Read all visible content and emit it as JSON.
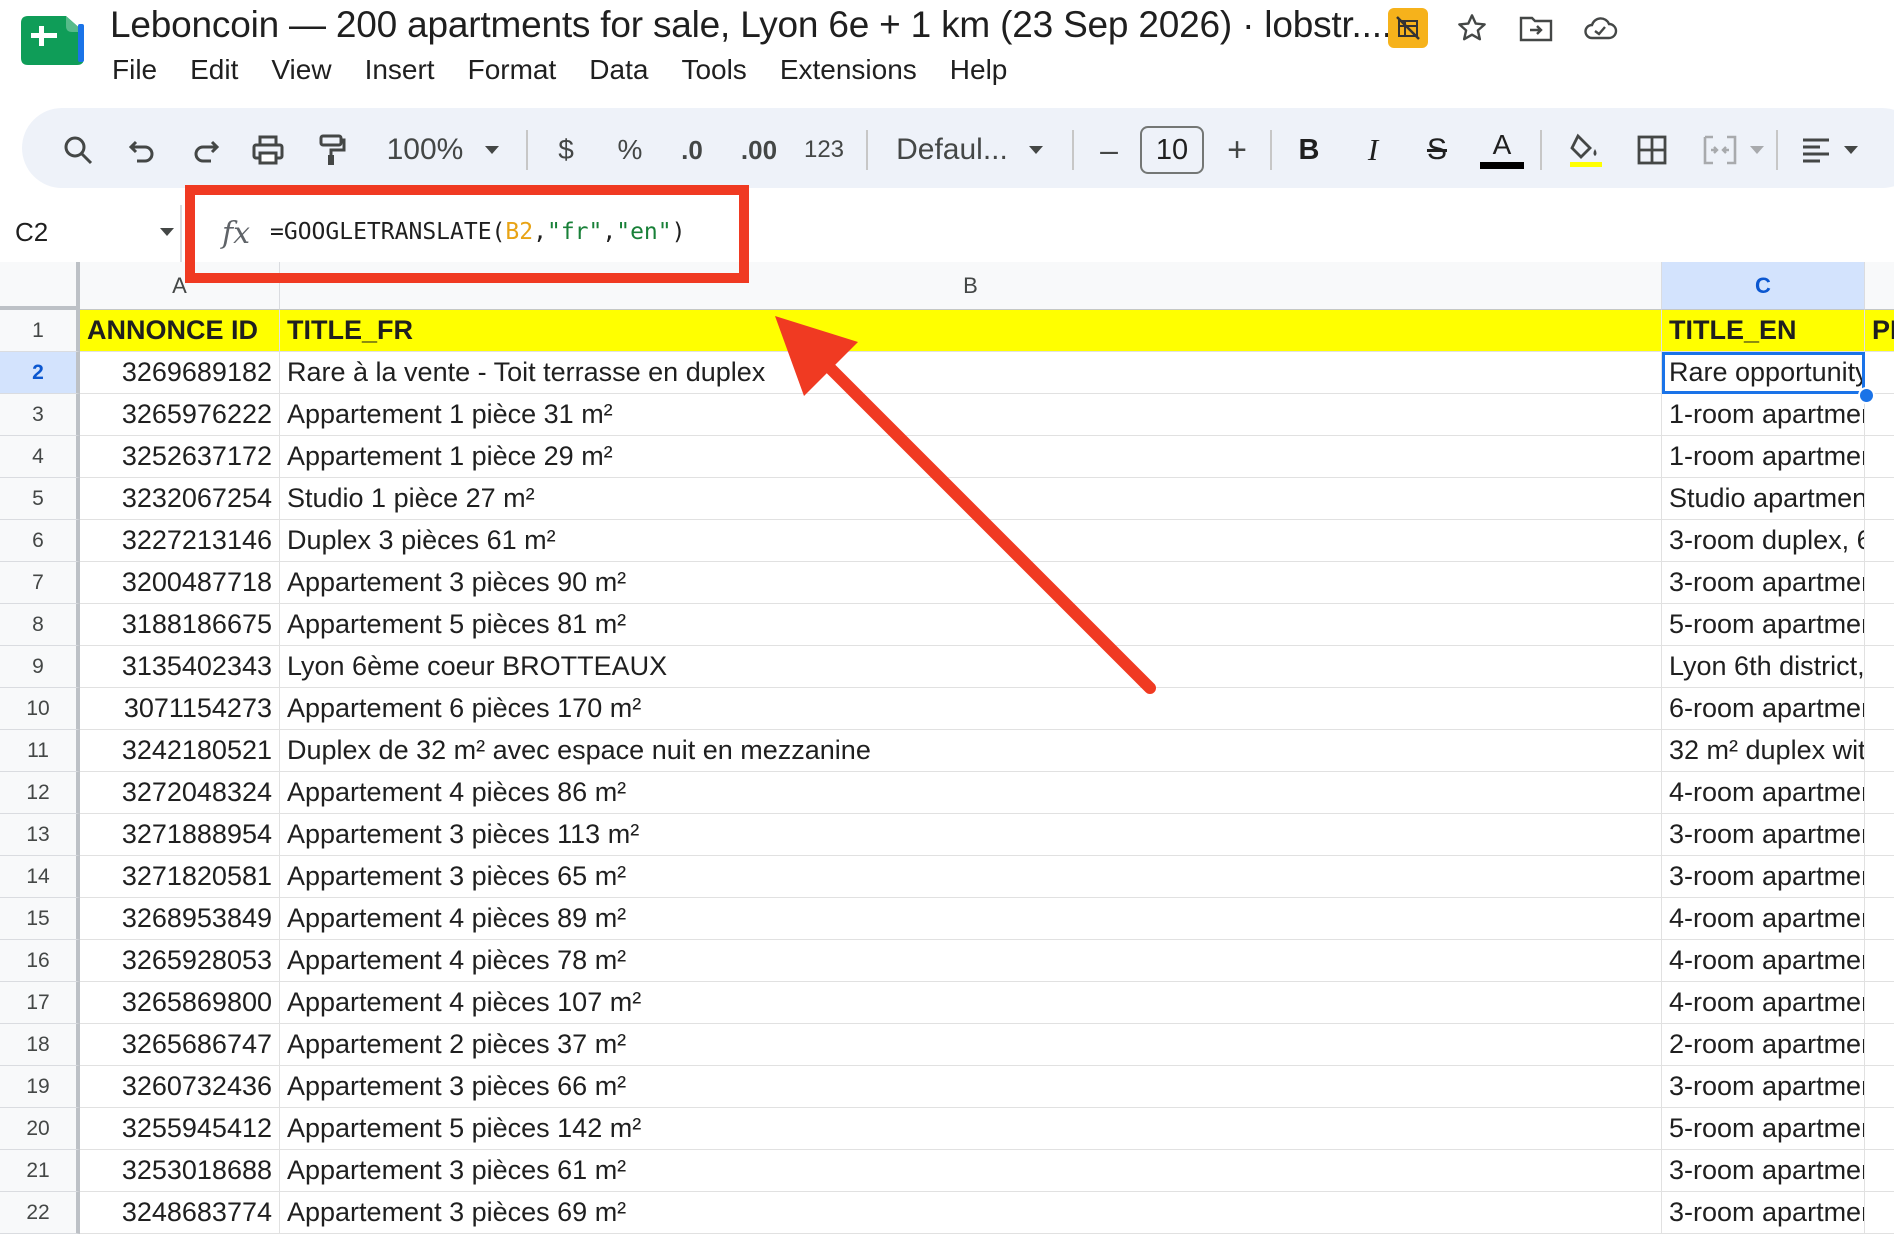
{
  "title": {
    "doc_title": "Leboncoin — 200 apartments for sale, Lyon 6e + 1 km (23 Sep 2026) · lobstr....",
    "icons": [
      "no-formatting-icon",
      "star-icon",
      "move-to-folder-icon",
      "cloud-saved-icon"
    ]
  },
  "menu": [
    "File",
    "Edit",
    "View",
    "Insert",
    "Format",
    "Data",
    "Tools",
    "Extensions",
    "Help"
  ],
  "toolbar": {
    "zoom": "100%",
    "currency": "$",
    "percent": "%",
    "decrease_decimal": ".0",
    "increase_decimal": ".00",
    "number_format": "123",
    "font": "Defaul...",
    "font_size": "10",
    "minus": "–",
    "plus": "+",
    "bold": "B",
    "italic": "I",
    "strike": "S",
    "text_color": "A"
  },
  "formula_bar": {
    "cell_ref": "C2",
    "fx": "fx",
    "formula_prefix": "=GOOGLETRANSLATE(",
    "formula_ref": "B2",
    "formula_comma1": ",",
    "formula_arg1": "\"fr\"",
    "formula_comma2": ",",
    "formula_arg2": "\"en\"",
    "formula_suffix": ")"
  },
  "columns": [
    "A",
    "B",
    "C"
  ],
  "header_row": {
    "row": "1",
    "a": "ANNONCE ID",
    "b": "TITLE_FR",
    "c": "TITLE_EN",
    "d": "PI"
  },
  "rows": [
    {
      "n": "2",
      "id": "3269689182",
      "fr": "Rare à la vente - Toit terrasse en duplex",
      "en": "Rare opportunity"
    },
    {
      "n": "3",
      "id": "3265976222",
      "fr": "Appartement 1 pièce 31 m²",
      "en": "1-room apartmen"
    },
    {
      "n": "4",
      "id": "3252637172",
      "fr": "Appartement 1 pièce 29 m²",
      "en": "1-room apartmen"
    },
    {
      "n": "5",
      "id": "3232067254",
      "fr": "Studio 1 pièce 27 m²",
      "en": "Studio apartmen"
    },
    {
      "n": "6",
      "id": "3227213146",
      "fr": "Duplex 3 pièces 61 m²",
      "en": "3-room duplex, 6"
    },
    {
      "n": "7",
      "id": "3200487718",
      "fr": "Appartement 3 pièces 90 m²",
      "en": "3-room apartmen"
    },
    {
      "n": "8",
      "id": "3188186675",
      "fr": "Appartement 5 pièces 81 m²",
      "en": "5-room apartmen"
    },
    {
      "n": "9",
      "id": "3135402343",
      "fr": "Lyon 6ème coeur BROTTEAUX",
      "en": "Lyon 6th district,"
    },
    {
      "n": "10",
      "id": "3071154273",
      "fr": "Appartement 6 pièces 170 m²",
      "en": "6-room apartmen"
    },
    {
      "n": "11",
      "id": "3242180521",
      "fr": "Duplex de 32 m² avec espace nuit en mezzanine",
      "en": "32 m² duplex wit"
    },
    {
      "n": "12",
      "id": "3272048324",
      "fr": "Appartement 4 pièces 86 m²",
      "en": "4-room apartmen"
    },
    {
      "n": "13",
      "id": "3271888954",
      "fr": "Appartement 3 pièces 113 m²",
      "en": "3-room apartmen"
    },
    {
      "n": "14",
      "id": "3271820581",
      "fr": "Appartement 3 pièces 65 m²",
      "en": "3-room apartmen"
    },
    {
      "n": "15",
      "id": "3268953849",
      "fr": "Appartement 4 pièces 89 m²",
      "en": "4-room apartmen"
    },
    {
      "n": "16",
      "id": "3265928053",
      "fr": "Appartement 4 pièces 78 m²",
      "en": "4-room apartmen"
    },
    {
      "n": "17",
      "id": "3265869800",
      "fr": "Appartement 4 pièces 107 m²",
      "en": "4-room apartmen"
    },
    {
      "n": "18",
      "id": "3265686747",
      "fr": "Appartement 2 pièces 37 m²",
      "en": "2-room apartmen"
    },
    {
      "n": "19",
      "id": "3260732436",
      "fr": "Appartement 3 pièces 66 m²",
      "en": "3-room apartmen"
    },
    {
      "n": "20",
      "id": "3255945412",
      "fr": "Appartement 5 pièces 142 m²",
      "en": "5-room apartmen"
    },
    {
      "n": "21",
      "id": "3253018688",
      "fr": "Appartement 3 pièces 61 m²",
      "en": "3-room apartmen"
    },
    {
      "n": "22",
      "id": "3248683774",
      "fr": "Appartement 3 pièces 69 m²",
      "en": "3-room apartmen"
    }
  ],
  "colors": {
    "header_fill": "#ffff00",
    "selection": "#1a73e8",
    "annotation": "#f03a22"
  }
}
